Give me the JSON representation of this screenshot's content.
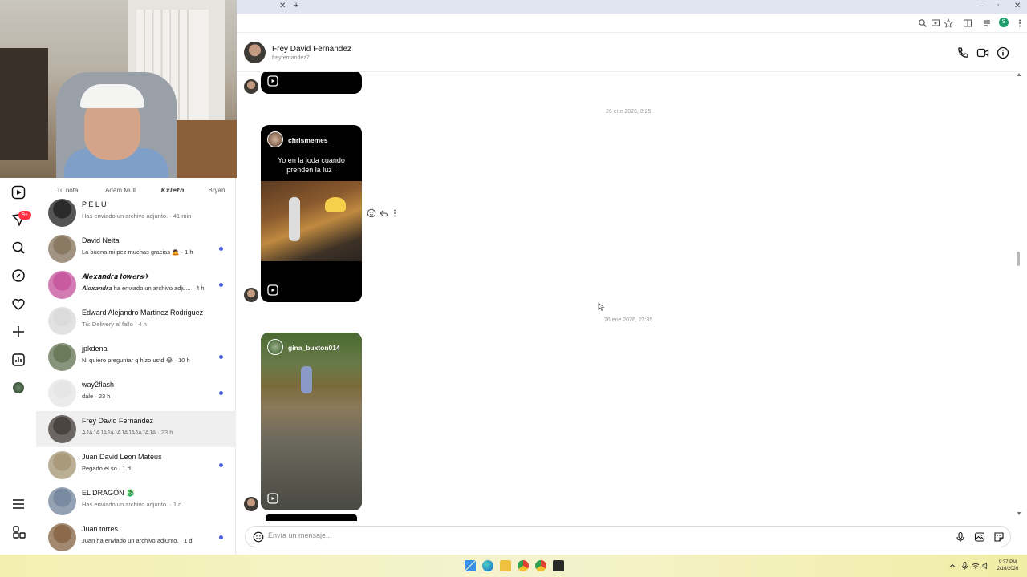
{
  "browser": {
    "tab_close": "✕",
    "new_tab": "+",
    "win_min": "–",
    "win_max": "▫",
    "win_close": "✕",
    "profile_initial": "S"
  },
  "notes": {
    "items": [
      {
        "label": "Tu nota"
      },
      {
        "label": "Adam Mull"
      },
      {
        "label": "𝙆𝙭𝙡𝙚𝙩𝙝"
      },
      {
        "label": "Bryan"
      }
    ]
  },
  "nav": {
    "notification_badge": "9+"
  },
  "conversations": [
    {
      "name": "P E L U",
      "preview": "Has enviado un archivo adjunto. · 41 min",
      "unread": false,
      "avatar_color": "#2a2a2a"
    },
    {
      "name": "David Neita",
      "preview": "La buena mi pez muchas gracias 🙇 · 1 h",
      "unread": true,
      "avatar_color": "#8a7a64"
    },
    {
      "name": "𝑨𝒍𝒆𝒙𝒂𝒏𝒅𝒓𝒂 𝒕𝒐𝒘𝒆𝒓𝒔✈",
      "preview": "𝑨𝒍𝒆𝒙𝒂𝒏𝒅𝒓𝒂 ha enviado un archivo adju... · 4 h",
      "unread": true,
      "avatar_color": "#c85aa0"
    },
    {
      "name": "Edward Alejandro Martinez Rodriguez",
      "preview": "Tú: Delivery al fallo · 4 h",
      "unread": false,
      "avatar_color": "#dbdbdb"
    },
    {
      "name": "jpkdena",
      "preview": "Ni quiero preguntar q hizo ustd 😂 · 10 h",
      "unread": true,
      "avatar_color": "#6b7a5a"
    },
    {
      "name": "way2flash",
      "preview": "dale · 23 h",
      "unread": true,
      "avatar_color": "#e6e6e6"
    },
    {
      "name": "Frey David Fernandez",
      "preview": "AJAJAJAJAJAJAJAJAJAJA · 23 h",
      "unread": false,
      "avatar_color": "#4a4440",
      "selected": true
    },
    {
      "name": "Juan David Leon Mateus",
      "preview": "Pegado el so · 1 d",
      "unread": true,
      "avatar_color": "#a89a7a"
    },
    {
      "name": "EL DRAGÓN 🐉",
      "preview": "Has enviado un archivo adjunto. · 1 d",
      "unread": false,
      "avatar_color": "#7a8aa0"
    },
    {
      "name": "Juan torres",
      "preview": "Juan ha enviado un archivo adjunto. · 1 d",
      "unread": true,
      "avatar_color": "#8a6a4a"
    }
  ],
  "chat": {
    "name": "Frey David Fernandez",
    "username": "freyfernandez7",
    "timestamps": [
      "26 ene 2026, 8:25",
      "26 ene 2026, 22:35"
    ],
    "reel1": {
      "author": "chrismemes_",
      "caption": "Yo en la joda cuando prenden la luz :"
    },
    "reel2": {
      "author": "gina_buxton014"
    },
    "composer_placeholder": "Envía un mensaje..."
  },
  "taskbar": {
    "time": "9:37 PM",
    "date": "2/16/2026"
  },
  "colors": {
    "unread_dot": "#4a5ee8",
    "badge": "#ff3040",
    "taskbar": "#f2f0b0"
  }
}
